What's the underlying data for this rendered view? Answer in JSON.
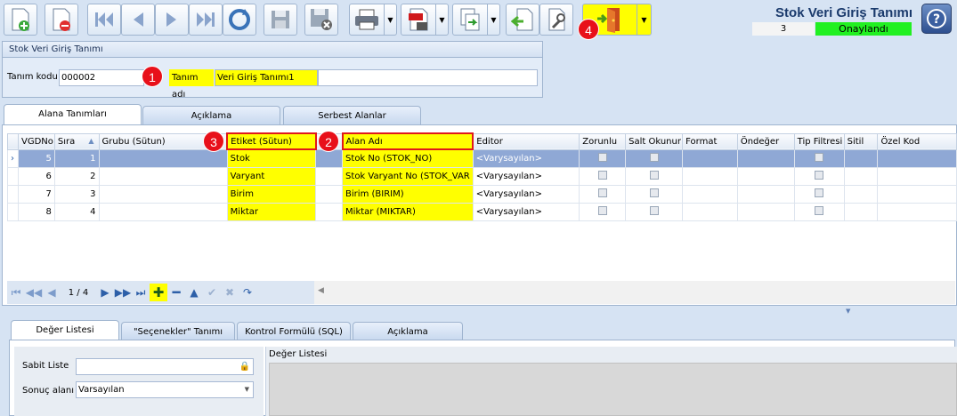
{
  "toolbar": {
    "buttons": [
      "new-icon",
      "delete-icon",
      "first-icon",
      "prev-icon",
      "next-icon",
      "last-icon",
      "refresh-icon",
      "save-icon",
      "save-close-icon",
      "print-icon",
      "pdf-icon",
      "export-icon",
      "import-icon",
      "tools-icon",
      "exit-icon"
    ]
  },
  "header": {
    "title": "Stok Veri Giriş Tanımı",
    "record_no": "3",
    "status": "Onaylandı",
    "status_color": "#21f021"
  },
  "group": {
    "title": "Stok Veri Giriş Tanımı",
    "code_label": "Tanım kodu",
    "code_value": "000002",
    "name_label": "Tanım adı",
    "name_value": "Veri Giriş Tanımı1"
  },
  "markers": [
    "1",
    "2",
    "3",
    "4"
  ],
  "tabs": [
    "Alana Tanımları",
    "Açıklama",
    "Serbest Alanlar"
  ],
  "grid": {
    "columns": [
      "VGDNo",
      "Sıra",
      "Grubu (Sütun)",
      "Etiket (Sütun)",
      "Alan Adı",
      "Editor",
      "Zorunlu",
      "Salt Okunur",
      "Format",
      "Öndeğer",
      "Tip Filtresi",
      "Sitil",
      "Özel Kod"
    ],
    "rows": [
      {
        "vgdno": "5",
        "sira": "1",
        "grubu": "",
        "etiket": "Stok",
        "alan": "Stok No (STOK_NO)",
        "editor": "<Varysayılan>"
      },
      {
        "vgdno": "6",
        "sira": "2",
        "grubu": "",
        "etiket": "Varyant",
        "alan": "Stok Varyant No (STOK_VAR",
        "editor": "<Varysayılan>"
      },
      {
        "vgdno": "7",
        "sira": "3",
        "grubu": "",
        "etiket": "Birim",
        "alan": "Birim (BIRIM)",
        "editor": "<Varysayılan>"
      },
      {
        "vgdno": "8",
        "sira": "4",
        "grubu": "",
        "etiket": "Miktar",
        "alan": "Miktar (MIKTAR)",
        "editor": "<Varysayılan>"
      }
    ]
  },
  "navigator": {
    "page": "1 / 4"
  },
  "lower_tabs": [
    "Değer Listesi",
    "\"Seçenekler\" Tanımı",
    "Kontrol Formülü (SQL)",
    "Açıklama"
  ],
  "lower": {
    "fixed_list_label": "Sabit Liste",
    "result_label": "Sonuç alanı",
    "result_value": "Varsayılan",
    "value_list_label": "Değer Listesi"
  },
  "colors": {
    "highlight": "#ffff00",
    "marker": "#e8101a",
    "selected_row": "#8fa8d5"
  }
}
